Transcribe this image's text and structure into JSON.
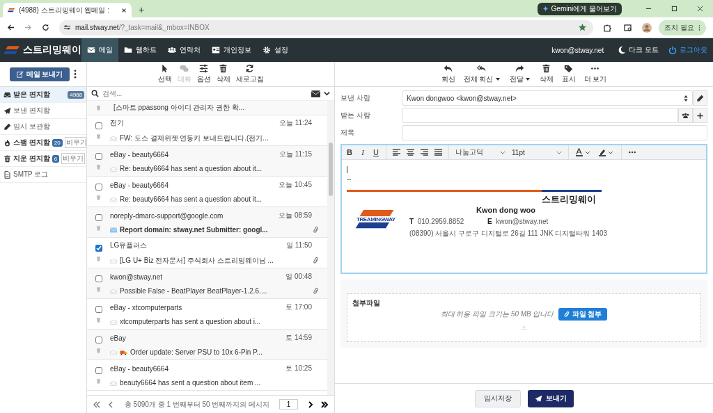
{
  "browser": {
    "tab_title": "(4988) 스트리밍웨이 웹메일 :",
    "new_tab": "+",
    "gemini": "Gemini에게 물어보기",
    "url_host": "mail.stway.net",
    "url_path": "/?_task=mail&_mbox=INBOX",
    "action_button": "조치 필요"
  },
  "header": {
    "brand": "스트리밍웨이",
    "nav": [
      {
        "label": "메일",
        "kind": "mail",
        "selected": true
      },
      {
        "label": "웹하드",
        "kind": "folder",
        "selected": false
      },
      {
        "label": "연락처",
        "kind": "users",
        "selected": false
      },
      {
        "label": "개인정보",
        "kind": "card",
        "selected": false
      },
      {
        "label": "설정",
        "kind": "gear",
        "selected": false
      }
    ],
    "user": "kwon@stway.net",
    "dark_mode": "다크 모드",
    "logout": "로그아웃"
  },
  "compose_button": "메일 보내기",
  "folders": [
    {
      "label": "받은 편지함",
      "kind": "inbox",
      "selected": true,
      "count": "4988"
    },
    {
      "label": "보낸 편지함",
      "kind": "plane",
      "selected": false
    },
    {
      "label": "임시 보관함",
      "kind": "pencil",
      "selected": false
    },
    {
      "label": "스팸 편지함",
      "kind": "fire",
      "selected": false,
      "count": "20",
      "action": "비우기"
    },
    {
      "label": "지운 편지함",
      "kind": "trash",
      "selected": false,
      "count": "6",
      "action": "비우기"
    },
    {
      "label": "SMTP 로그",
      "kind": "file",
      "selected": false
    }
  ],
  "list_toolbar": [
    {
      "label": "선택",
      "kind": "pointer",
      "disabled": false
    },
    {
      "label": "대화",
      "kind": "chat",
      "disabled": true
    },
    {
      "label": "옵션",
      "kind": "sliders",
      "disabled": false
    },
    {
      "label": "삭제",
      "kind": "trash",
      "disabled": false
    },
    {
      "label": "새로고침",
      "kind": "refresh",
      "disabled": false
    }
  ],
  "search": {
    "placeholder": "검색..."
  },
  "top_partial_subject": "[스마트       ppassong 아이디 관리자 권한 확...",
  "messages": [
    {
      "sender": "전기",
      "time": "오늘 11:24",
      "subject": "FW: 도스 결제위젯 연동키 보내드립니다.(전기...",
      "kind": "text",
      "checked": false,
      "unread": false,
      "attachment": false
    },
    {
      "sender": "eBay - beauty6664",
      "time": "오늘 11:15",
      "subject": "Re: beauty6664 has sent a question about it...",
      "kind": "text",
      "checked": false,
      "unread": false,
      "attachment": false
    },
    {
      "sender": "eBay - beauty6664",
      "time": "오늘 10:45",
      "subject": "Re: beauty6664 has sent a question about it...",
      "kind": "text",
      "checked": false,
      "unread": false,
      "attachment": false
    },
    {
      "sender": "noreply-dmarc-support@google.com",
      "time": "오늘 08:59",
      "subject": "Report domain: stway.net Submitter: googl...",
      "kind": "text",
      "checked": false,
      "unread": true,
      "attachment": true
    },
    {
      "sender": "LG유플러스",
      "time": "일 11:50",
      "subject": "[LG U+ Biz 전자문서] 주식회사 스트리밍웨이님 ...",
      "kind": "text",
      "checked": true,
      "unread": false,
      "attachment": true
    },
    {
      "sender": "kwon@stway.net",
      "time": "일 00:48",
      "subject": "Possible False - BeatPlayer BeatPlayer-1.2.6....",
      "kind": "text",
      "checked": false,
      "unread": false,
      "attachment": true
    },
    {
      "sender": "eBay - xtcomputerparts",
      "time": "토 17:00",
      "subject": "xtcomputerparts has sent a question about i...",
      "kind": "text",
      "checked": false,
      "unread": false,
      "attachment": false
    },
    {
      "sender": "eBay",
      "time": "토 14:59",
      "subject": "Order update: Server PSU to 10x 6-Pin P...",
      "kind": "truck",
      "checked": false,
      "unread": false,
      "attachment": false
    },
    {
      "sender": "eBay - beauty6664",
      "time": "토 10:25",
      "subject": "beauty6664 has sent a question about item ...",
      "kind": "text",
      "checked": false,
      "unread": false,
      "attachment": false
    }
  ],
  "pagination": {
    "summary": "총 5090개 중 1 번째부터 50 번째까지의 메시지",
    "page": "1"
  },
  "reader_toolbar": [
    {
      "label": "회신",
      "kind": "reply",
      "dropdown": false
    },
    {
      "label": "전체 회신",
      "kind": "reply-all",
      "dropdown": true
    },
    {
      "label": "전달",
      "kind": "forward",
      "dropdown": true
    },
    {
      "label": "삭제",
      "kind": "trash",
      "dropdown": false
    },
    {
      "label": "표시",
      "kind": "tag",
      "dropdown": false
    },
    {
      "label": "더 보기",
      "kind": "dots",
      "dropdown": false
    }
  ],
  "compose": {
    "from_label": "보낸 사람",
    "from_value": "Kwon dongwoo <kwon@stway.net>",
    "to_label": "받는 사람",
    "subject_label": "제목"
  },
  "editor": {
    "format_buttons": [
      "B",
      "I",
      "U"
    ],
    "font": "나눔고딕",
    "size": "11pt"
  },
  "signature": {
    "separator": "--",
    "company": "스트리밍웨이",
    "logo_text": "TREAMINGWAY",
    "name": "Kwon dong woo",
    "phone_label": "T",
    "phone": "010.2959.8852",
    "email_label": "E",
    "email": "kwon@stway.net",
    "address": "(08390) 서울시 구로구 디지털로 26길 111 JNK 디지털타워 1403"
  },
  "attachments": {
    "title": "첨부파일",
    "hint": "최대 허용 파일 크기는 50 MB 입니다",
    "button": "파일 첨부"
  },
  "footer": {
    "save": "임시저장",
    "send": "보내기"
  }
}
